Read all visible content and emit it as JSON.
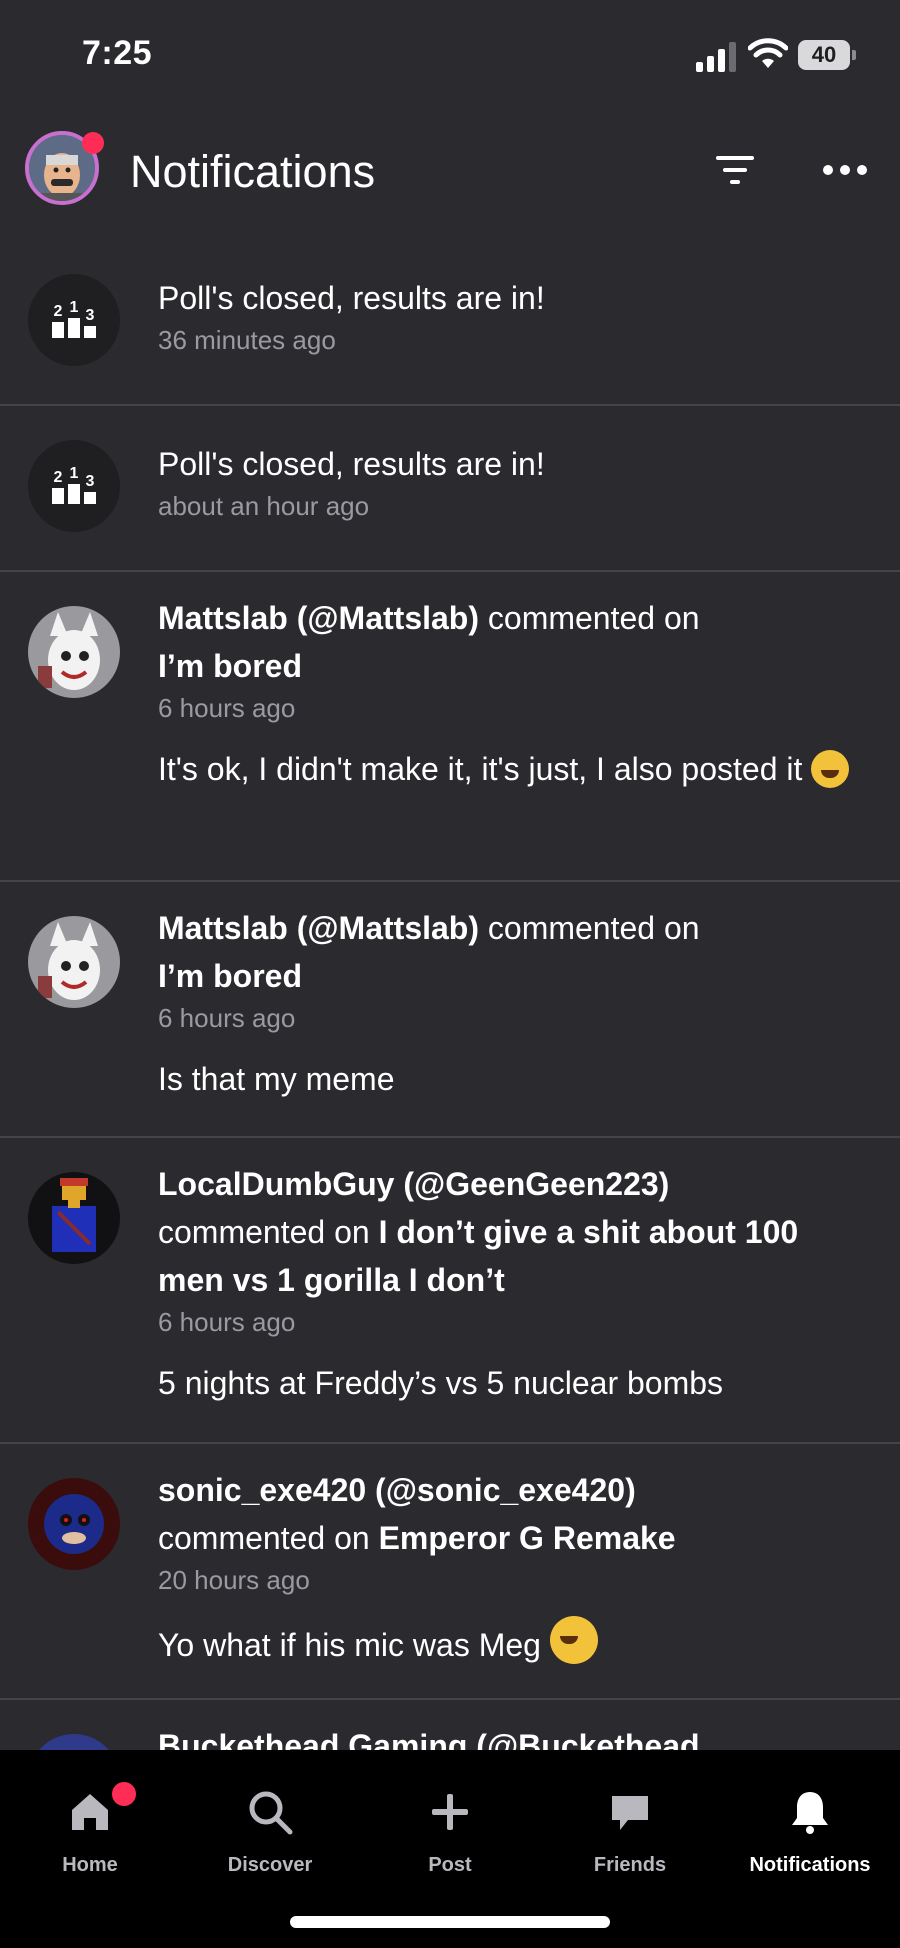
{
  "status": {
    "time": "7:25",
    "battery": "40"
  },
  "header": {
    "title": "Notifications"
  },
  "notifications": [
    {
      "kind": "poll",
      "title": "Poll's closed, results are in!",
      "time": "36 minutes ago"
    },
    {
      "kind": "poll",
      "title": "Poll's closed, results are in!",
      "time": "about an hour ago"
    },
    {
      "kind": "comment",
      "user": "Mattslab (@Mattslab)",
      "action": "commented on",
      "post": "I’m bored",
      "time": "6 hours ago",
      "comment": "It's ok, I didn't make it, it's just, I also posted it"
    },
    {
      "kind": "comment",
      "user": "Mattslab (@Mattslab)",
      "action": "commented on",
      "post": "I’m bored",
      "time": "6 hours ago",
      "comment": "Is that my meme"
    },
    {
      "kind": "comment",
      "user": "LocalDumbGuy (@GeenGeen223)",
      "action": "commented on",
      "post": "I don’t give a shit about 100 men vs 1 gorilla I don’t",
      "time": "6 hours ago",
      "comment": "5 nights at Freddy’s vs 5 nuclear bombs"
    },
    {
      "kind": "comment",
      "user": "sonic_exe420 (@sonic_exe420)",
      "action": "commented on",
      "post": "Emperor G Remake",
      "time": "20 hours ago",
      "comment": "Yo what if his mic was Meg"
    },
    {
      "kind": "comment",
      "user": "Buckethead Gaming (@Buckethead"
    }
  ],
  "tabs": [
    {
      "label": "Home",
      "icon": "home-icon"
    },
    {
      "label": "Discover",
      "icon": "search-icon"
    },
    {
      "label": "Post",
      "icon": "plus-icon"
    },
    {
      "label": "Friends",
      "icon": "chat-icon"
    },
    {
      "label": "Notifications",
      "icon": "bell-icon"
    }
  ],
  "colors": {
    "background": "#2b2a2f",
    "accent_dot": "#ff2d55",
    "tabbar": "#000000",
    "muted_text": "#9b9aa1"
  }
}
